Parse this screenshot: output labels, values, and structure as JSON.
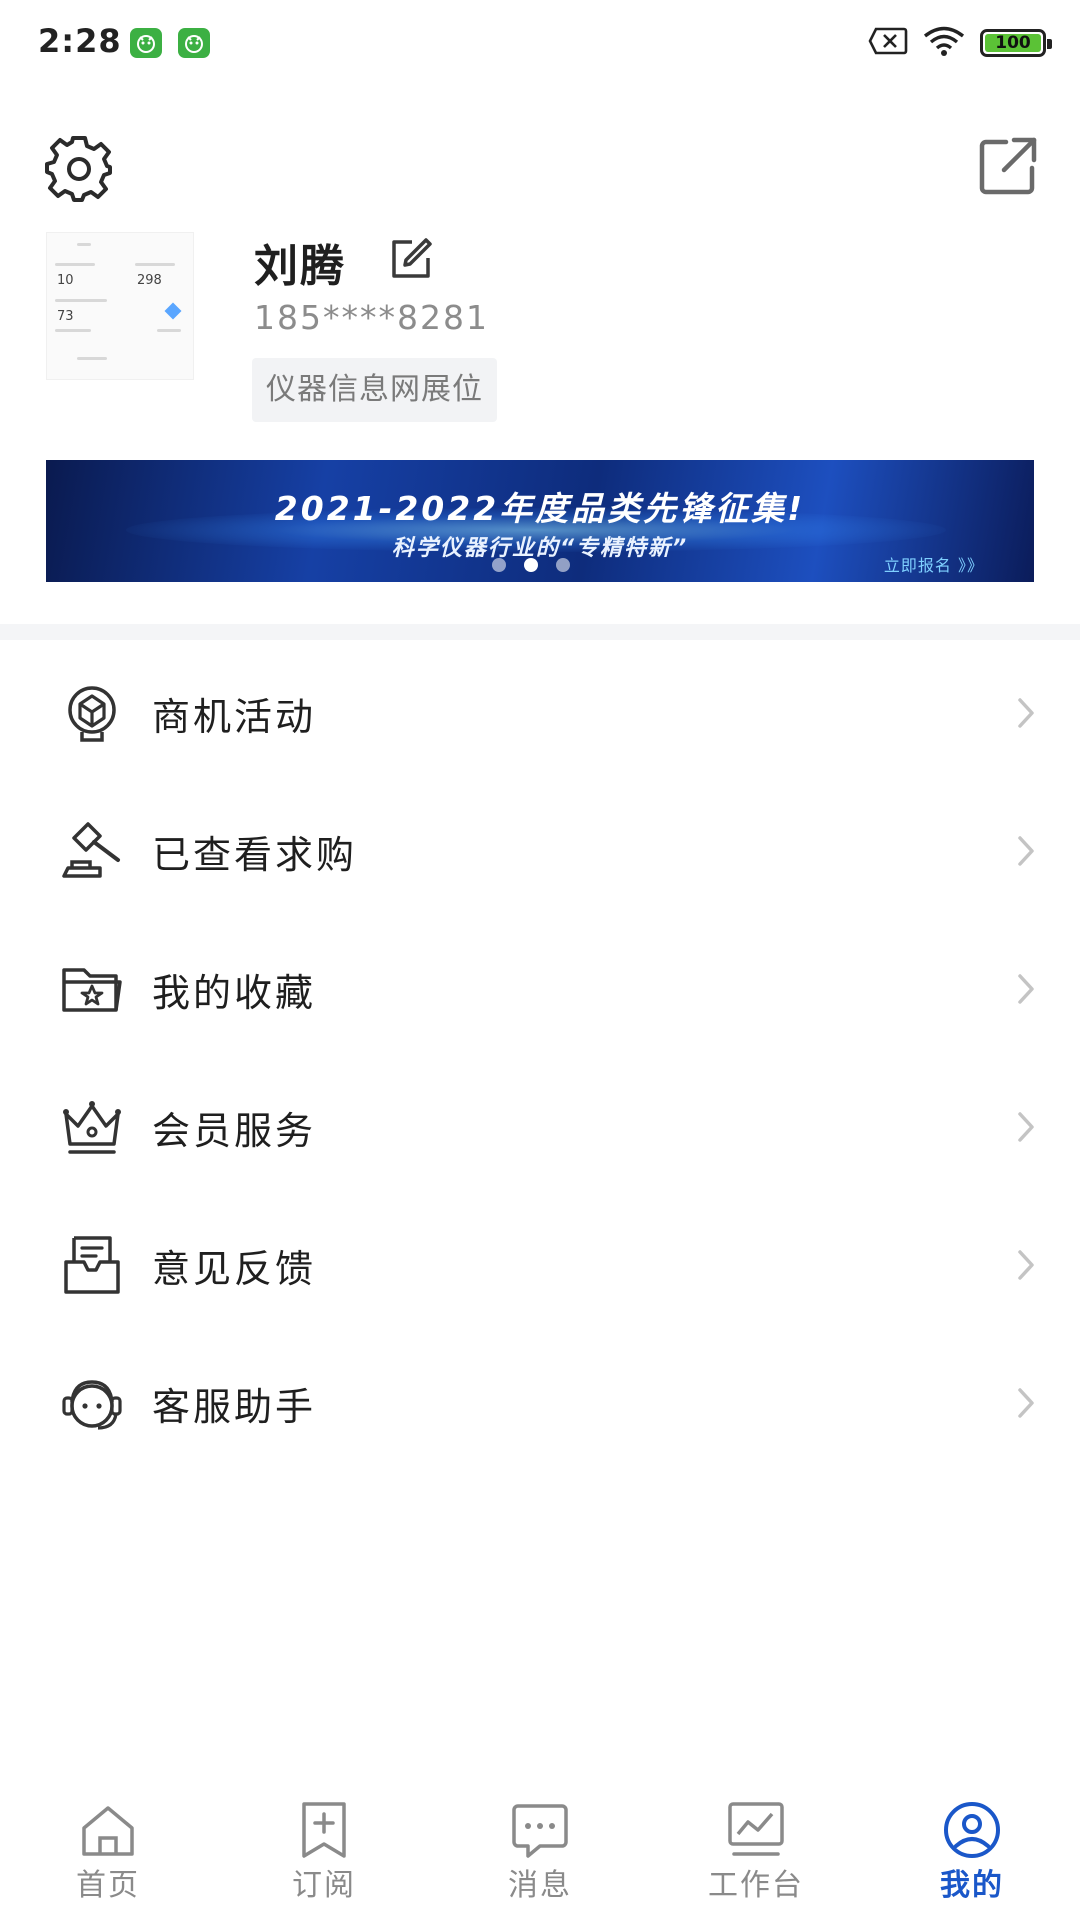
{
  "status_bar": {
    "time": "2:28",
    "battery": "100",
    "icons": [
      "app-notification-icon",
      "app-notification-icon",
      "sim-off-icon",
      "wifi-icon",
      "battery-icon"
    ]
  },
  "header": {
    "settings_icon": "gear-icon",
    "share_icon": "external-link-icon"
  },
  "profile": {
    "name": "刘腾",
    "phone": "185****8281",
    "tag": "仪器信息网展位",
    "avatar_numbers": [
      "10",
      "298",
      "73"
    ]
  },
  "banner": {
    "title": "2021-2022年度品类先锋征集!",
    "subtitle": "科学仪器行业的“专精特新”",
    "cta": "立即报名 》》",
    "active_dot": 1,
    "dot_count": 3
  },
  "menu": {
    "items": [
      {
        "label": "商机活动",
        "icon": "business-opportunity-icon"
      },
      {
        "label": "已查看求购",
        "icon": "gavel-icon"
      },
      {
        "label": "我的收藏",
        "icon": "star-folder-icon"
      },
      {
        "label": "会员服务",
        "icon": "crown-icon"
      },
      {
        "label": "意见反馈",
        "icon": "feedback-inbox-icon"
      },
      {
        "label": "客服助手",
        "icon": "headset-icon"
      }
    ]
  },
  "bottom_nav": {
    "items": [
      {
        "label": "首页",
        "icon": "home-icon"
      },
      {
        "label": "订阅",
        "icon": "subscribe-icon"
      },
      {
        "label": "消息",
        "icon": "message-icon"
      },
      {
        "label": "工作台",
        "icon": "workbench-icon"
      },
      {
        "label": "我的",
        "icon": "user-icon"
      }
    ],
    "active_index": 4
  },
  "colors": {
    "accent": "#1a57c9",
    "text": "#1f1f1f",
    "muted": "#8c8c8c",
    "tag_bg": "#f2f3f5"
  }
}
